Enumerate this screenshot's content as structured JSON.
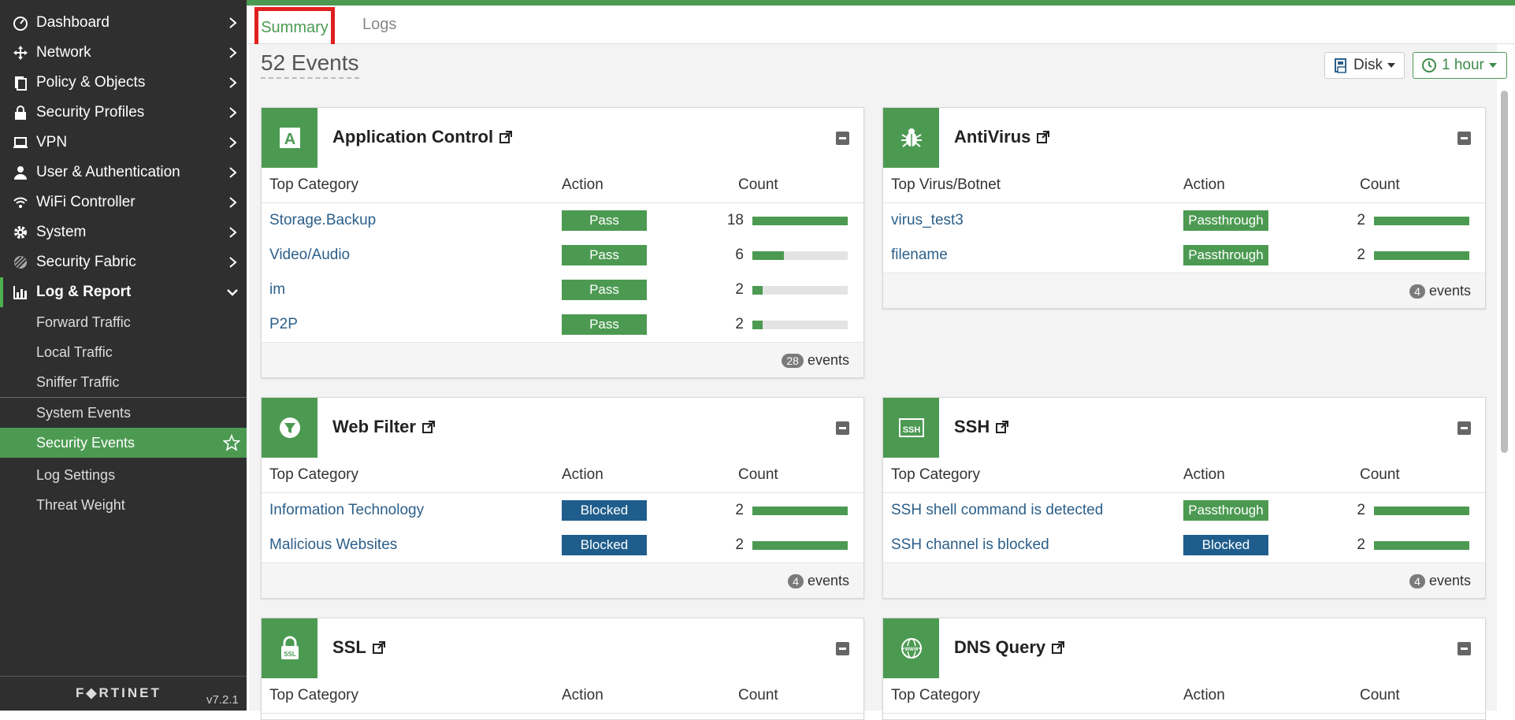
{
  "sidebar": {
    "items": [
      {
        "label": "Dashboard",
        "icon": "dashboard-icon"
      },
      {
        "label": "Network",
        "icon": "network-icon"
      },
      {
        "label": "Policy & Objects",
        "icon": "policy-icon"
      },
      {
        "label": "Security Profiles",
        "icon": "lock-icon"
      },
      {
        "label": "VPN",
        "icon": "laptop-icon"
      },
      {
        "label": "User & Authentication",
        "icon": "user-icon"
      },
      {
        "label": "WiFi Controller",
        "icon": "wifi-icon"
      },
      {
        "label": "System",
        "icon": "gear-icon"
      },
      {
        "label": "Security Fabric",
        "icon": "fabric-icon"
      },
      {
        "label": "Log & Report",
        "icon": "chart-icon"
      }
    ],
    "subitems": [
      {
        "label": "Forward Traffic"
      },
      {
        "label": "Local Traffic"
      },
      {
        "label": "Sniffer Traffic"
      },
      {
        "label": "System Events"
      },
      {
        "label": "Security Events"
      },
      {
        "label": "Log Settings"
      },
      {
        "label": "Threat Weight"
      }
    ],
    "brand": "F◆RTINET",
    "version": "v7.2.1"
  },
  "tabs": {
    "summary": "Summary",
    "logs": "Logs"
  },
  "header": {
    "events_title": "52 Events",
    "disk_label": "Disk",
    "time_label": "1 hour"
  },
  "colors": {
    "accent": "#4c9a52",
    "blocked": "#1f5e8c",
    "sidebar": "#2f2f2f",
    "highlight": "#e0201f"
  },
  "cards": {
    "app_control": {
      "title": "Application Control",
      "icon": "application-icon",
      "cols": [
        "Top Category",
        "Action",
        "Count"
      ],
      "rows": [
        {
          "name": "Storage.Backup",
          "action": "Pass",
          "count": "18",
          "fill": 1.0
        },
        {
          "name": "Video/Audio",
          "action": "Pass",
          "count": "6",
          "fill": 0.333
        },
        {
          "name": "im",
          "action": "Pass",
          "count": "2",
          "fill": 0.111
        },
        {
          "name": "P2P",
          "action": "Pass",
          "count": "2",
          "fill": 0.111
        }
      ],
      "events_count": "28",
      "events_label": "events"
    },
    "antivirus": {
      "title": "AntiVirus",
      "icon": "bug-icon",
      "cols": [
        "Top Virus/Botnet",
        "Action",
        "Count"
      ],
      "rows": [
        {
          "name": "virus_test3",
          "action": "Passthrough",
          "count": "2",
          "fill": 1.0
        },
        {
          "name": "filename",
          "action": "Passthrough",
          "count": "2",
          "fill": 1.0
        }
      ],
      "events_count": "4",
      "events_label": "events"
    },
    "web_filter": {
      "title": "Web Filter",
      "icon": "filter-icon",
      "cols": [
        "Top Category",
        "Action",
        "Count"
      ],
      "rows": [
        {
          "name": "Information Technology",
          "action": "Blocked",
          "count": "2",
          "fill": 1.0
        },
        {
          "name": "Malicious Websites",
          "action": "Blocked",
          "count": "2",
          "fill": 1.0
        }
      ],
      "events_count": "4",
      "events_label": "events"
    },
    "ssh": {
      "title": "SSH",
      "icon": "ssh-icon",
      "icon_text": "SSH",
      "cols": [
        "Top Category",
        "Action",
        "Count"
      ],
      "rows": [
        {
          "name": "SSH shell command is detected",
          "action": "Passthrough",
          "count": "2",
          "fill": 1.0
        },
        {
          "name": "SSH channel is blocked",
          "action": "Blocked",
          "count": "2",
          "fill": 1.0
        }
      ],
      "events_count": "4",
      "events_label": "events"
    },
    "ssl": {
      "title": "SSL",
      "icon": "ssl-lock-icon",
      "icon_text": "SSL",
      "cols": [
        "Top Category",
        "Action",
        "Count"
      ]
    },
    "dns": {
      "title": "DNS Query",
      "icon": "globe-icon",
      "icon_text": "WWW",
      "cols": [
        "Top Category",
        "Action",
        "Count"
      ]
    }
  }
}
